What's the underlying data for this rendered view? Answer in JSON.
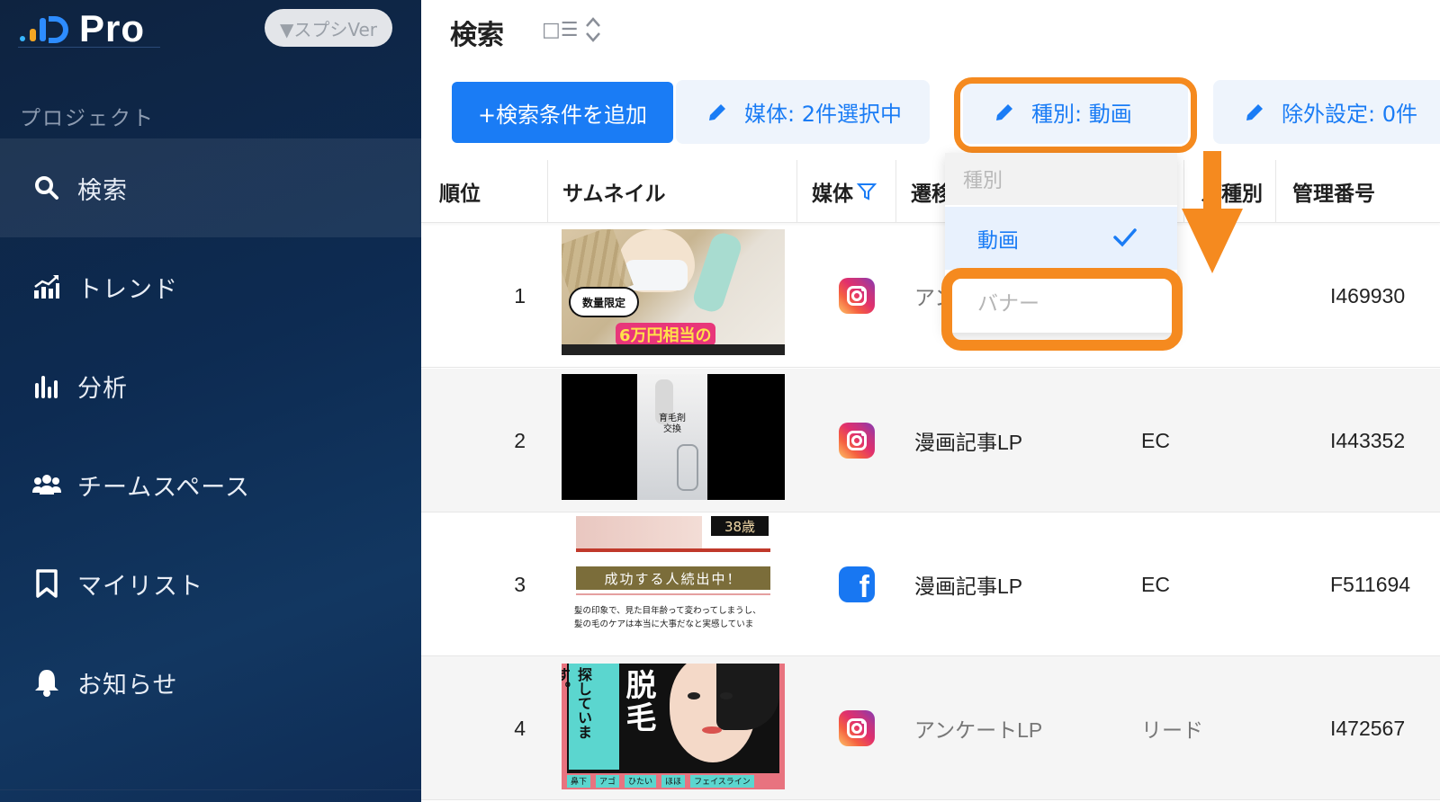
{
  "app": {
    "brand": "Pro",
    "version_badge": "▼スプシVer"
  },
  "sidebar": {
    "section_label": "プロジェクト",
    "items": [
      {
        "label": "検索",
        "icon": "search-icon",
        "active": true
      },
      {
        "label": "トレンド",
        "icon": "trend-chart-icon",
        "active": false
      },
      {
        "label": "分析",
        "icon": "bar-chart-icon",
        "active": false
      },
      {
        "label": "チームスペース",
        "icon": "team-icon",
        "active": false
      },
      {
        "label": "マイリスト",
        "icon": "bookmark-icon",
        "active": false
      },
      {
        "label": "お知らせ",
        "icon": "bell-icon",
        "active": false
      }
    ]
  },
  "main": {
    "title": "検索",
    "view_toggle": "□☰",
    "add_condition_label": "+検索条件を追加",
    "filters": [
      {
        "label": "媒体: 2件選択中"
      },
      {
        "label": "種別: 動画"
      },
      {
        "label": "除外設定: 0件"
      }
    ]
  },
  "table": {
    "columns": [
      "順位",
      "サムネイル",
      "媒体",
      "遷移先",
      "ル種別",
      "管理番号"
    ],
    "rows": [
      {
        "rank": "1",
        "media": "instagram",
        "transition": "アンケ",
        "type": "",
        "id": "I469930",
        "thumb_texts": [
          "数量限定",
          "6万円相当の"
        ]
      },
      {
        "rank": "2",
        "media": "instagram",
        "transition": "漫画記事LP",
        "type": "EC",
        "id": "I443352",
        "thumb_texts": [
          "育毛剤",
          "交換"
        ]
      },
      {
        "rank": "3",
        "media": "facebook",
        "transition": "漫画記事LP",
        "type": "EC",
        "id": "F511694",
        "thumb_texts": [
          "38歳",
          "成功する人続出中！",
          "髪の印象で、見た目年齢って変わってしまうし、",
          "髪の毛のケアは本当に大事だなと実感していま"
        ]
      },
      {
        "rank": "4",
        "media": "instagram",
        "transition": "アンケートLP",
        "type": "リード",
        "id": "I472567",
        "thumb_texts": [
          "脱毛",
          "探しています。",
          "鼻下",
          "アゴ",
          "ひたい",
          "ほほ",
          "フェイスライン"
        ]
      }
    ]
  },
  "dropdown": {
    "header": "種別",
    "options": [
      {
        "label": "動画",
        "selected": true
      },
      {
        "label": "バナー",
        "selected": false
      }
    ]
  },
  "colors": {
    "accent": "#1a7cf5",
    "highlight": "#f58a1f",
    "sidebar_bg": "#0d2b52"
  }
}
